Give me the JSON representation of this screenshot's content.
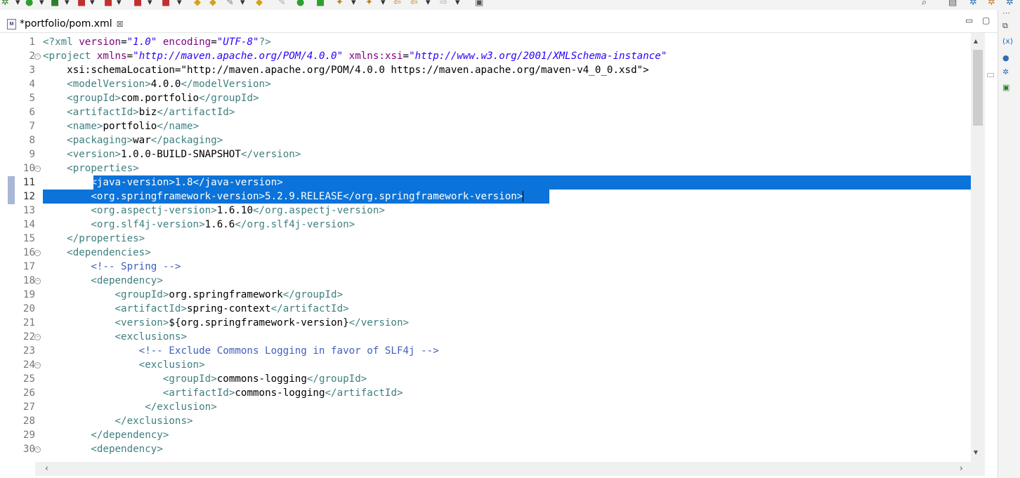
{
  "editor": {
    "tab_label": "*portfolio/pom.xml",
    "file_icon": "M",
    "lines": [
      {
        "n": "1",
        "fold": false,
        "sel": false,
        "text": "<?xml version=\"1.0\" encoding=\"UTF-8\"?>"
      },
      {
        "n": "2",
        "fold": true,
        "sel": false,
        "text": "<project xmlns=\"http://maven.apache.org/POM/4.0.0\" xmlns:xsi=\"http://www.w3.org/2001/XMLSchema-instance\""
      },
      {
        "n": "3",
        "fold": false,
        "sel": false,
        "text": "    xsi:schemaLocation=\"http://maven.apache.org/POM/4.0.0 https://maven.apache.org/maven-v4_0_0.xsd\">"
      },
      {
        "n": "4",
        "fold": false,
        "sel": false,
        "text": "    <modelVersion>4.0.0</modelVersion>"
      },
      {
        "n": "5",
        "fold": false,
        "sel": false,
        "text": "    <groupId>com.portfolio</groupId>"
      },
      {
        "n": "6",
        "fold": false,
        "sel": false,
        "text": "    <artifactId>biz</artifactId>"
      },
      {
        "n": "7",
        "fold": false,
        "sel": false,
        "text": "    <name>portfolio</name>"
      },
      {
        "n": "8",
        "fold": false,
        "sel": false,
        "text": "    <packaging>war</packaging>"
      },
      {
        "n": "9",
        "fold": false,
        "sel": false,
        "text": "    <version>1.0.0-BUILD-SNAPSHOT</version>"
      },
      {
        "n": "10",
        "fold": true,
        "sel": false,
        "text": "    <properties>"
      },
      {
        "n": "11",
        "fold": false,
        "sel": true,
        "text": "        <java-version>1.8</java-version>"
      },
      {
        "n": "12",
        "fold": false,
        "sel": true,
        "text": "        <org.springframework-version>5.2.9.RELEASE</org.springframework-version>"
      },
      {
        "n": "13",
        "fold": false,
        "sel": false,
        "text": "        <org.aspectj-version>1.6.10</org.aspectj-version>"
      },
      {
        "n": "14",
        "fold": false,
        "sel": false,
        "text": "        <org.slf4j-version>1.6.6</org.slf4j-version>"
      },
      {
        "n": "15",
        "fold": false,
        "sel": false,
        "text": "    </properties>"
      },
      {
        "n": "16",
        "fold": true,
        "sel": false,
        "text": "    <dependencies>"
      },
      {
        "n": "17",
        "fold": false,
        "sel": false,
        "text": "        <!-- Spring -->"
      },
      {
        "n": "18",
        "fold": true,
        "sel": false,
        "text": "        <dependency>"
      },
      {
        "n": "19",
        "fold": false,
        "sel": false,
        "text": "            <groupId>org.springframework</groupId>"
      },
      {
        "n": "20",
        "fold": false,
        "sel": false,
        "text": "            <artifactId>spring-context</artifactId>"
      },
      {
        "n": "21",
        "fold": false,
        "sel": false,
        "text": "            <version>${org.springframework-version}</version>"
      },
      {
        "n": "22",
        "fold": true,
        "sel": false,
        "text": "            <exclusions>"
      },
      {
        "n": "23",
        "fold": false,
        "sel": false,
        "text": "                <!-- Exclude Commons Logging in favor of SLF4j -->"
      },
      {
        "n": "24",
        "fold": true,
        "sel": false,
        "text": "                <exclusion>"
      },
      {
        "n": "25",
        "fold": false,
        "sel": false,
        "text": "                    <groupId>commons-logging</groupId>"
      },
      {
        "n": "26",
        "fold": false,
        "sel": false,
        "text": "                    <artifactId>commons-logging</artifactId>"
      },
      {
        "n": "27",
        "fold": false,
        "sel": false,
        "text": "                 </exclusion>"
      },
      {
        "n": "28",
        "fold": false,
        "sel": false,
        "text": "            </exclusions>"
      },
      {
        "n": "29",
        "fold": false,
        "sel": false,
        "text": "        </dependency>"
      },
      {
        "n": "30",
        "fold": true,
        "sel": false,
        "text": "        <dependency>"
      }
    ]
  },
  "colors": {
    "selection": "#0b73d9",
    "tag": "#3f7f7f",
    "attribute": "#7f007f",
    "value": "#2a00ff",
    "comment": "#3f5fbf"
  },
  "icons": {
    "toolbar": [
      "debug-icon",
      "run-icon",
      "coverage-icon",
      "external-tools-icon",
      "stop-icon",
      "new-server-icon",
      "open-type-icon",
      "search-icon",
      "annotation-icon",
      "next-annotation-icon",
      "prev-annotation-icon",
      "back-icon",
      "forward-icon",
      "quick-access-icon",
      "perspective-icon"
    ],
    "trim": [
      "restore-icon",
      "variables-icon",
      "breakpoints-icon",
      "expressions-icon",
      "registers-icon"
    ]
  }
}
